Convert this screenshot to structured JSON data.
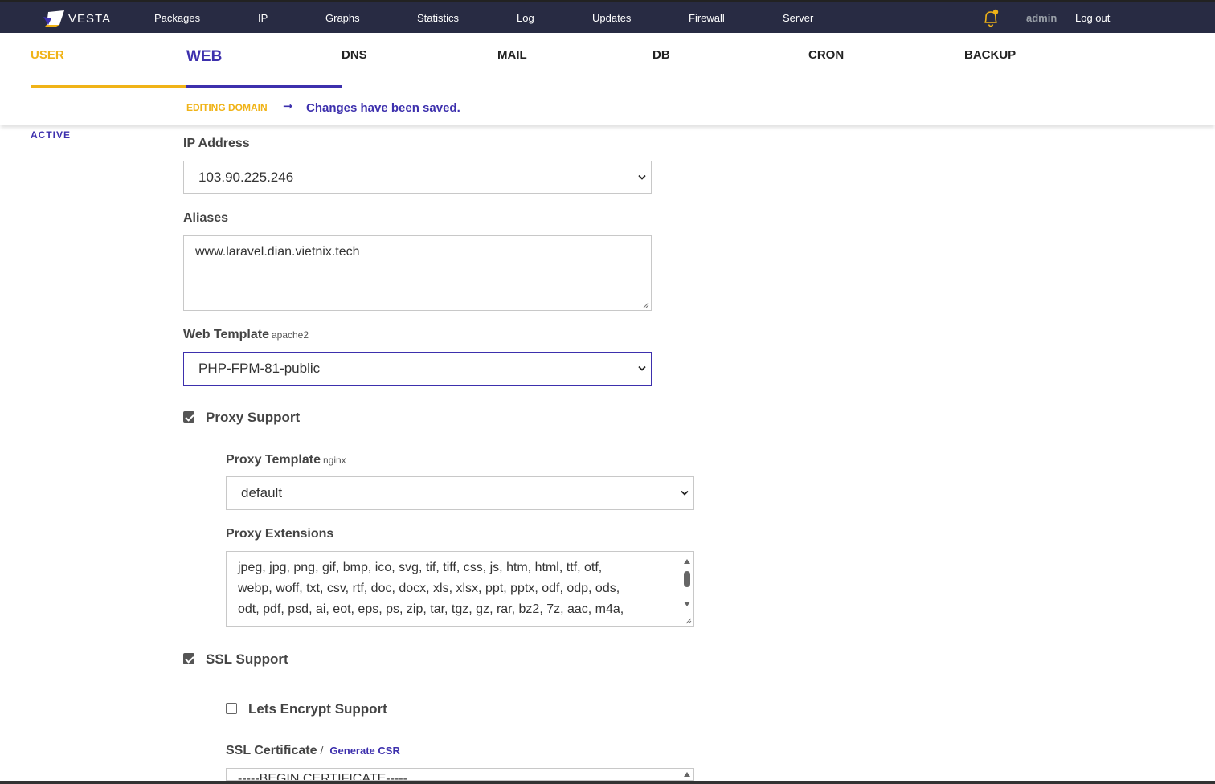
{
  "app": {
    "logo_text": "VESTA"
  },
  "topnav": {
    "items": [
      "Packages",
      "IP",
      "Graphs",
      "Statistics",
      "Log",
      "Updates",
      "Firewall",
      "Server"
    ],
    "user": "admin",
    "logout": "Log out"
  },
  "tabs": [
    "USER",
    "WEB",
    "DNS",
    "MAIL",
    "DB",
    "CRON",
    "BACKUP"
  ],
  "breadcrumb": {
    "section": "EDITING DOMAIN",
    "arrow": "➞",
    "message": "Changes have been saved."
  },
  "status": "ACTIVE",
  "form": {
    "ip_label": "IP Address",
    "ip_value": "103.90.225.246",
    "aliases_label": "Aliases",
    "aliases_value": "www.laravel.dian.vietnix.tech",
    "web_template_label": "Web Template",
    "web_template_sub": "apache2",
    "web_template_value": "PHP-FPM-81-public",
    "proxy_support_label": "Proxy Support",
    "proxy_support_checked": true,
    "proxy_template_label": "Proxy Template",
    "proxy_template_sub": "nginx",
    "proxy_template_value": "default",
    "proxy_ext_label": "Proxy Extensions",
    "proxy_ext_lines": [
      "jpeg, jpg, png, gif, bmp, ico, svg, tif, tiff, css, js, htm, html, ttf, otf,",
      "webp, woff, txt, csv, rtf, doc, docx, xls, xlsx, ppt, pptx, odf, odp, ods,",
      "odt, pdf, psd, ai, eot, eps, ps, zip, tar, tgz, gz, rar, bz2, 7z, aac, m4a,"
    ],
    "ssl_support_label": "SSL Support",
    "ssl_support_checked": true,
    "letsencrypt_label": "Lets Encrypt Support",
    "letsencrypt_checked": false,
    "ssl_cert_label": "SSL Certificate",
    "ssl_cert_slash": "/",
    "generate_csr": "Generate CSR",
    "ssl_cert_value": "-----BEGIN CERTIFICATE-----"
  },
  "colors": {
    "topbar": "#282b43",
    "accent": "#3d30ad",
    "user_tab": "#f0b317"
  }
}
